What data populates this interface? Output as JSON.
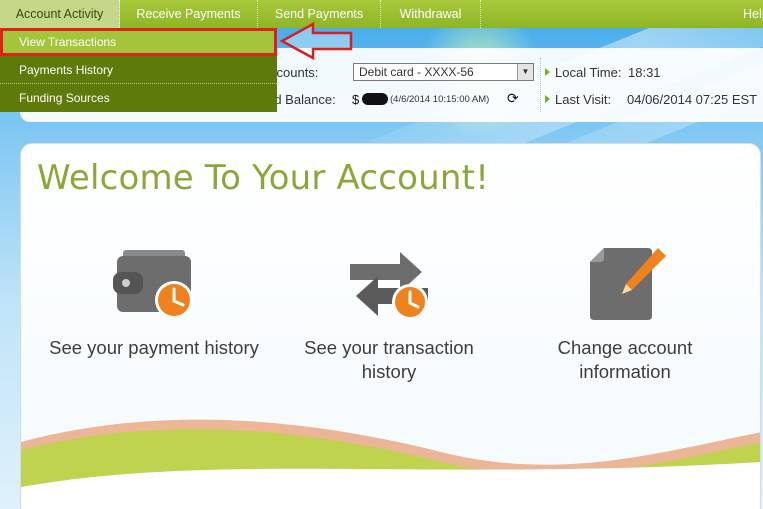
{
  "nav": {
    "tabs": [
      "Account Activity",
      "Receive Payments",
      "Send Payments",
      "Withdrawal"
    ],
    "help": "Help"
  },
  "dropdown": {
    "items": [
      "View Transactions",
      "Payments History",
      "Funding Sources"
    ]
  },
  "info": {
    "accounts_label": "ccounts:",
    "accounts_value": "Debit card - XXXX-56",
    "balance_label": "rd Balance:",
    "balance_currency": "$",
    "balance_time": "(4/6/2014 10:15:00 AM)",
    "local_time_label": "Local Time:",
    "local_time_value": "18:31",
    "last_visit_label": "Last Visit:",
    "last_visit_value": "04/06/2014 07:25 EST"
  },
  "main": {
    "title": "Welcome To Your Account!",
    "features": [
      {
        "label": "See your payment history",
        "icon": "wallet-clock-icon"
      },
      {
        "label": "See your transaction history",
        "icon": "transfer-arrows-clock-icon"
      },
      {
        "label": "Change account information",
        "icon": "document-edit-icon"
      }
    ]
  },
  "colors": {
    "nav_green": "#8eb527",
    "menu_dark_green": "#5e7a0a",
    "highlight_red": "#e0201b",
    "title_green": "#8da63c",
    "icon_orange": "#f0821e",
    "icon_gray": "#6d6d6d"
  }
}
